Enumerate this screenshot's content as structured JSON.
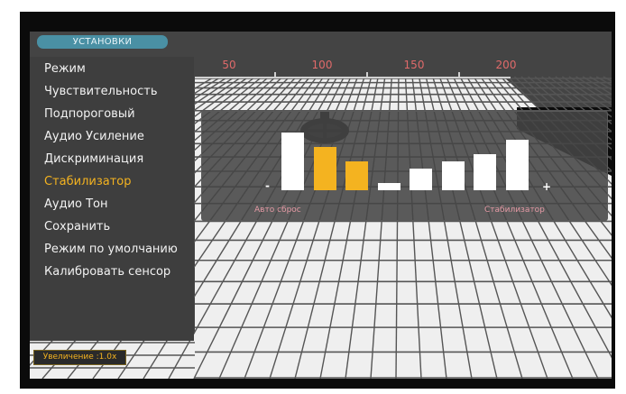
{
  "header": {
    "title": "УСТАНОВКИ"
  },
  "menu": {
    "items": [
      {
        "label": "Режим",
        "active": false
      },
      {
        "label": "Чувствительность",
        "active": false
      },
      {
        "label": "Подпороговый",
        "active": false
      },
      {
        "label": "Аудио Усиление",
        "active": false
      },
      {
        "label": "Дискриминация",
        "active": false
      },
      {
        "label": "Стабилизатор",
        "active": true
      },
      {
        "label": "Аудио Тон",
        "active": false
      },
      {
        "label": "Сохранить",
        "active": false
      },
      {
        "label": "Режим по умолчанию",
        "active": false
      },
      {
        "label": "Калибровать сенсор",
        "active": false
      }
    ]
  },
  "ruler": {
    "labels": [
      "50",
      "100",
      "150",
      "200"
    ]
  },
  "stabilizer": {
    "minus_label": "-",
    "plus_label": "+",
    "left_caption": "Авто сброс",
    "right_caption": "Стабилизатор",
    "levels": [
      8,
      6,
      4,
      1,
      3,
      4,
      5,
      7
    ],
    "selected_count": 2
  },
  "footer": {
    "zoom_label": "Увеличение :1.0x"
  },
  "colors": {
    "accent": "#f4b320",
    "tab": "#4a90a4",
    "ruler": "#e06a6a",
    "caption": "#e59aa5"
  },
  "icons": {
    "coil": "search-coil-icon"
  }
}
